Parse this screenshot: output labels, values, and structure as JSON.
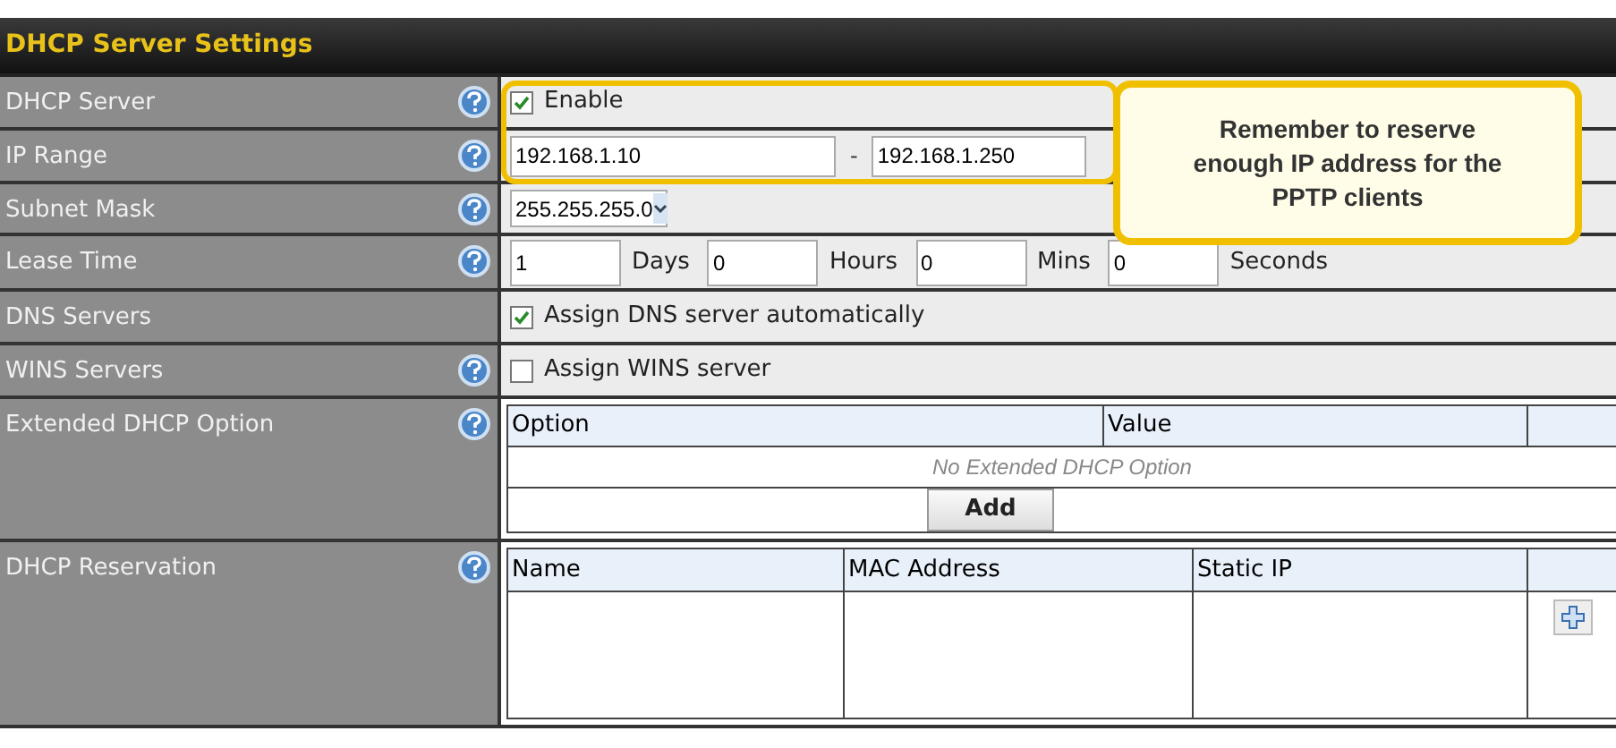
{
  "title": "DHCP Server Settings",
  "rows": [
    {
      "kind": "checkbox",
      "label": "DHCP Server",
      "help": true,
      "checked": true,
      "text": "Enable"
    },
    {
      "kind": "range",
      "label": "IP Range",
      "help": true,
      "from": "192.168.1.10",
      "separator": "-",
      "to": "192.168.1.250"
    },
    {
      "kind": "select",
      "label": "Subnet Mask",
      "help": true,
      "value": "255.255.255.0"
    },
    {
      "kind": "lease",
      "label": "Lease Time",
      "help": true,
      "parts": [
        {
          "value": "1",
          "unit": "Days"
        },
        {
          "value": "0",
          "unit": "Hours"
        },
        {
          "value": "0",
          "unit": "Mins"
        },
        {
          "value": "0",
          "unit": "Seconds"
        }
      ]
    },
    {
      "kind": "checkbox",
      "label": "DNS Servers",
      "help": false,
      "checked": true,
      "text": "Assign DNS server automatically"
    },
    {
      "kind": "checkbox",
      "label": "WINS Servers",
      "help": true,
      "checked": false,
      "text": "Assign WINS server"
    },
    {
      "kind": "options",
      "label": "Extended DHCP Option",
      "help": true,
      "columns": [
        "Option",
        "Value"
      ],
      "empty": "No Extended DHCP Option",
      "button": "Add"
    },
    {
      "kind": "reservation",
      "label": "DHCP Reservation",
      "help": true,
      "columns": [
        "Name",
        "MAC Address",
        "Static IP"
      ]
    }
  ],
  "callout": "Remember to reserve enough IP address for the PPTP clients"
}
